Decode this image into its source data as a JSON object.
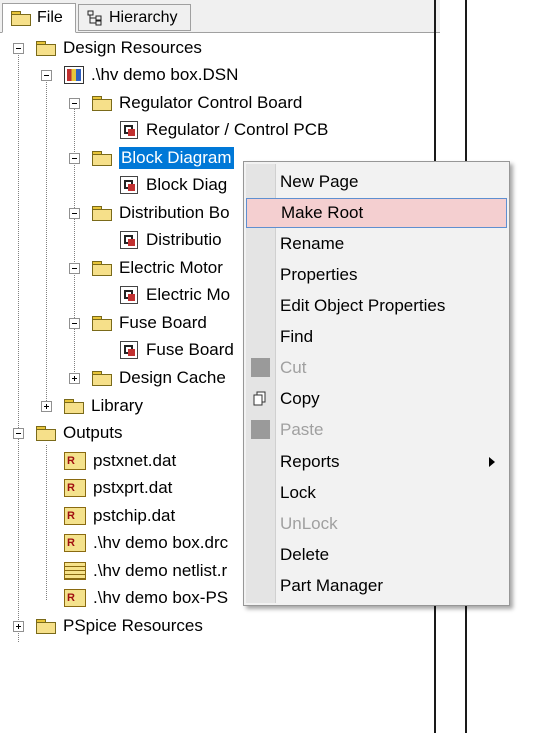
{
  "tabs": [
    {
      "label": "File",
      "icon": "folder-icon",
      "active": true
    },
    {
      "label": "Hierarchy",
      "icon": "hierarchy-icon",
      "active": false
    }
  ],
  "tree": {
    "design_resources": "Design Resources",
    "dsn_file": ".\\hv demo box.DSN",
    "regulator_board": "Regulator Control Board",
    "regulator_pcb": "Regulator / Control PCB",
    "block_diagram": "Block Diagram",
    "block_diagram_page": "Block Diag",
    "distribution_board": "Distribution Bo",
    "distribution_page": "Distributio",
    "electric_motor": "Electric Motor",
    "electric_motor_page": "Electric Mo",
    "fuse_board": "Fuse Board",
    "fuse_board_page": "Fuse Board",
    "design_cache": "Design Cache",
    "library": "Library",
    "outputs": "Outputs",
    "out1": "pstxnet.dat",
    "out2": "pstxprt.dat",
    "out3": "pstchip.dat",
    "out4": ".\\hv demo box.drc",
    "out5": ".\\hv demo netlist.r",
    "out6": ".\\hv demo box-PS",
    "pspice": "PSpice Resources"
  },
  "context_menu": {
    "items": [
      {
        "label": "New Page",
        "enabled": true
      },
      {
        "label": "Make Root",
        "enabled": true,
        "highlighted": true
      },
      {
        "label": "Rename",
        "enabled": true
      },
      {
        "label": "Properties",
        "enabled": true
      },
      {
        "label": "Edit Object Properties",
        "enabled": true
      },
      {
        "label": "Find",
        "enabled": true
      },
      {
        "label": "Cut",
        "enabled": false,
        "icon": "cut-icon"
      },
      {
        "label": "Copy",
        "enabled": true,
        "icon": "copy-icon"
      },
      {
        "label": "Paste",
        "enabled": false,
        "icon": "paste-icon"
      },
      {
        "label": "Reports",
        "enabled": true,
        "submenu": true
      },
      {
        "label": "Lock",
        "enabled": true
      },
      {
        "label": "UnLock",
        "enabled": false
      },
      {
        "label": "Delete",
        "enabled": true
      },
      {
        "label": "Part Manager",
        "enabled": true
      }
    ]
  },
  "colors": {
    "selection": "#0078d7",
    "menu_highlight": "#f4cfd0",
    "menu_bg": "#f2f2f2"
  }
}
